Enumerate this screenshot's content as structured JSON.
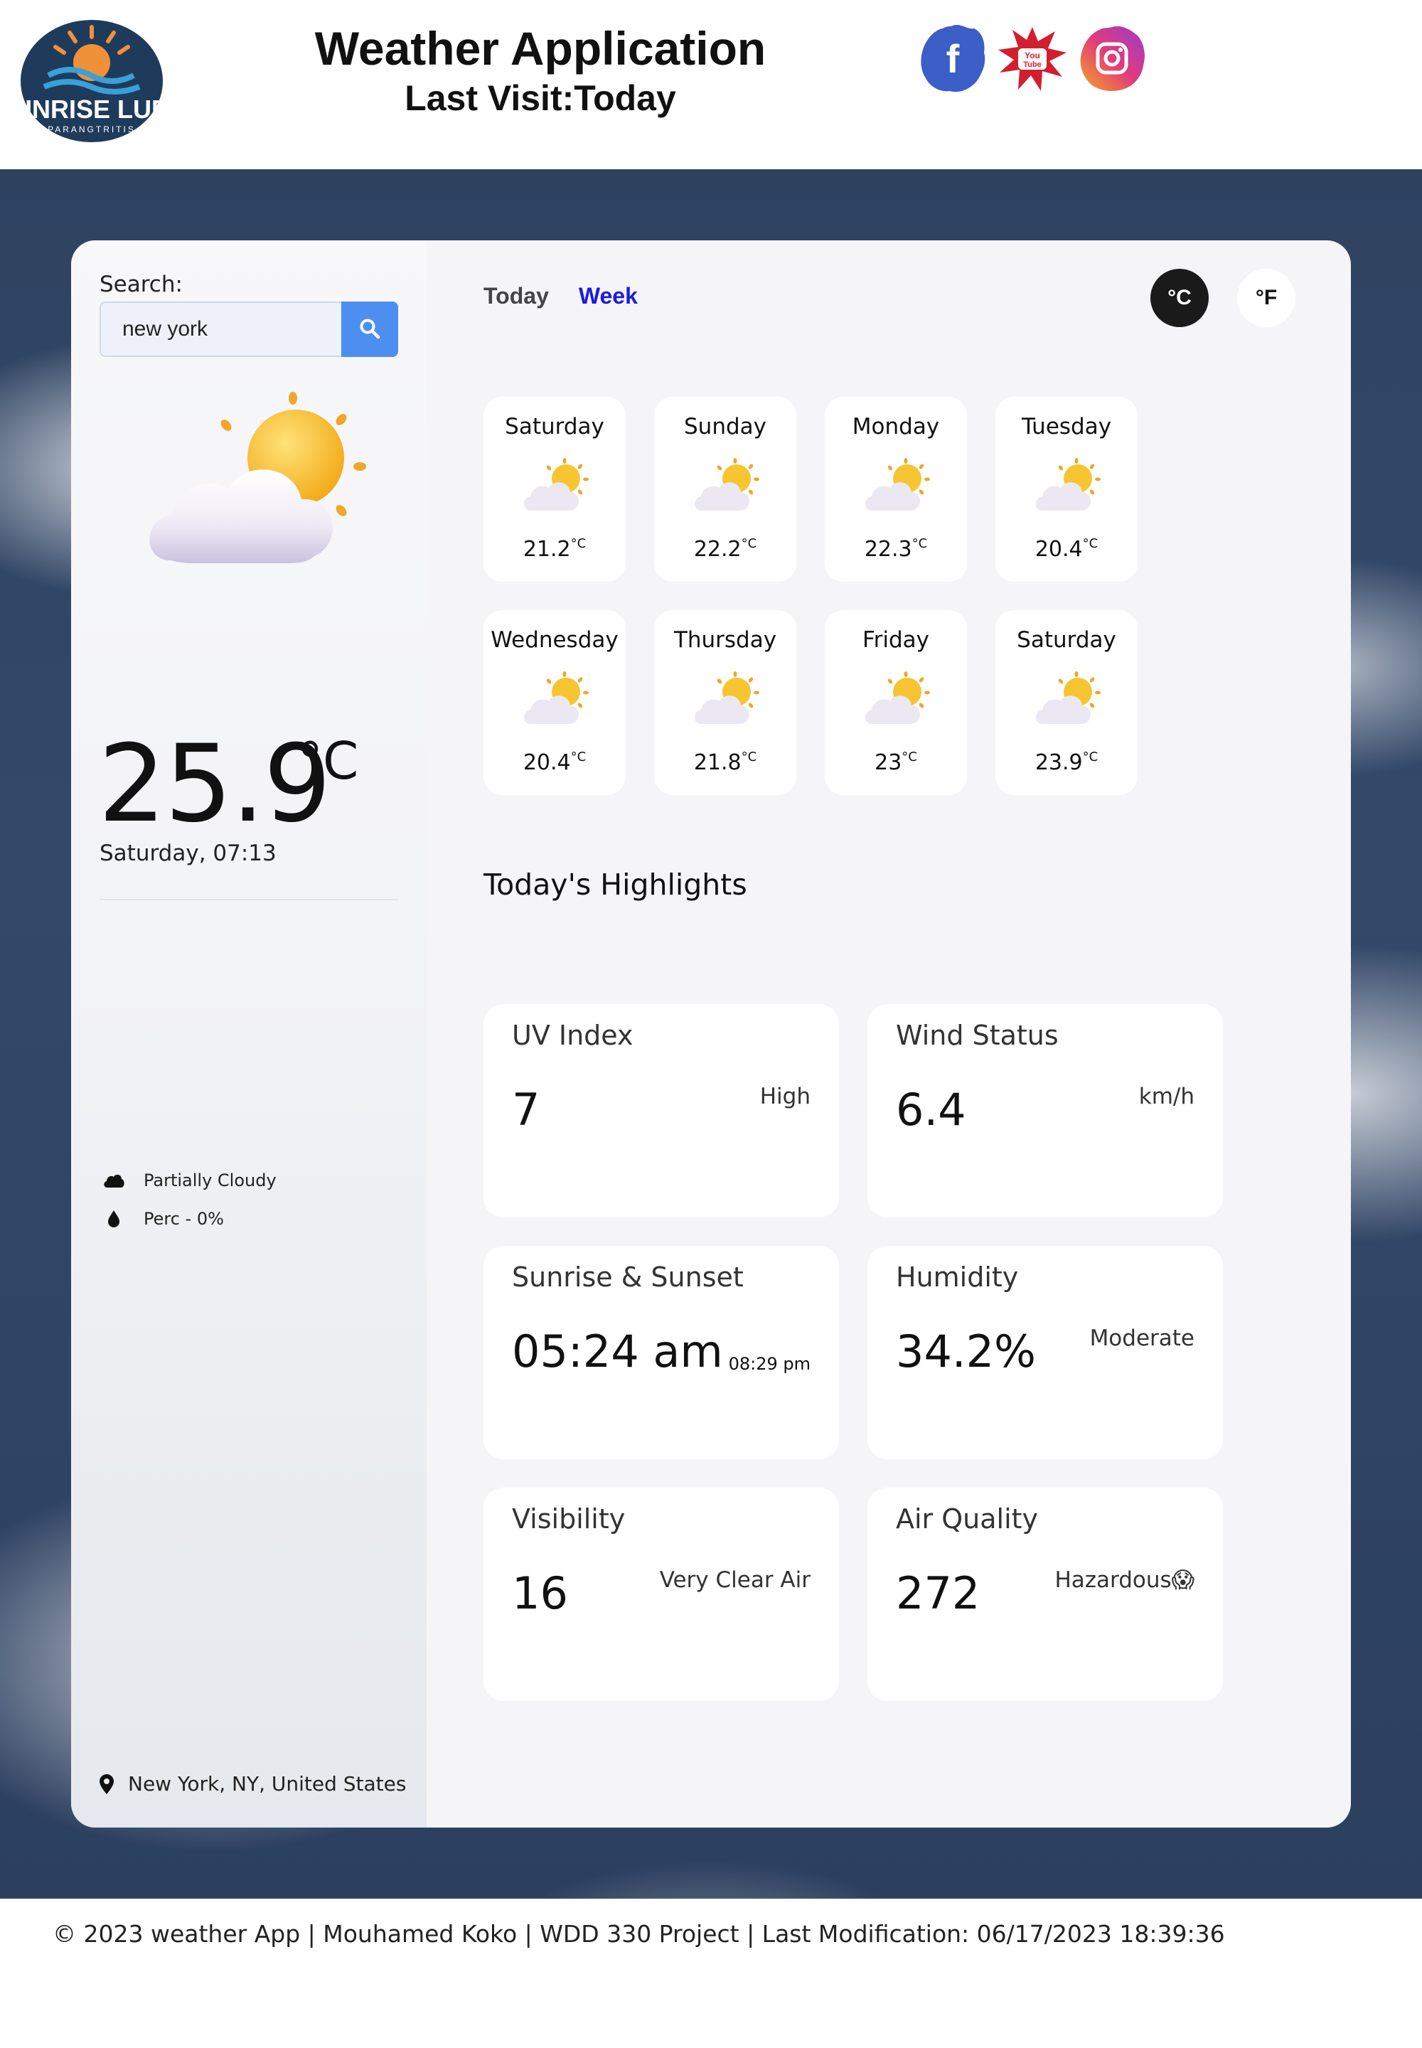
{
  "header": {
    "logo_text": "SUNRISE LURE",
    "logo_subtext": "PARANGTRITIS",
    "title": "Weather Application",
    "last_visit": "Last Visit:Today",
    "social": [
      {
        "name": "facebook",
        "icon": "facebook-icon",
        "color": "#3b5ec7"
      },
      {
        "name": "youtube",
        "icon": "youtube-icon",
        "color": "#d21f2f"
      },
      {
        "name": "instagram",
        "icon": "instagram-icon",
        "color": "#e23b7a"
      }
    ]
  },
  "sidebar": {
    "search_label": "Search:",
    "search_value": "new york",
    "search_icon": "search-icon",
    "current_temp": "25.9",
    "temp_unit": "°C",
    "datetime": "Saturday, 07:13",
    "conditions": [
      {
        "icon": "cloud-icon",
        "text": "Partially Cloudy"
      },
      {
        "icon": "drop-icon",
        "text": "Perc - 0%"
      }
    ],
    "location": "New York, NY, United States"
  },
  "tabs": {
    "today": "Today",
    "week": "Week"
  },
  "units": {
    "celsius": "°C",
    "fahrenheit": "°F"
  },
  "week": [
    {
      "day": "Saturday",
      "temp": "21.2",
      "unit": "°C"
    },
    {
      "day": "Sunday",
      "temp": "22.2",
      "unit": "°C"
    },
    {
      "day": "Monday",
      "temp": "22.3",
      "unit": "°C"
    },
    {
      "day": "Tuesday",
      "temp": "20.4",
      "unit": "°C"
    },
    {
      "day": "Wednesday",
      "temp": "20.4",
      "unit": "°C"
    },
    {
      "day": "Thursday",
      "temp": "21.8",
      "unit": "°C"
    },
    {
      "day": "Friday",
      "temp": "23",
      "unit": "°C"
    },
    {
      "day": "Saturday",
      "temp": "23.9",
      "unit": "°C"
    }
  ],
  "highlights": {
    "title": "Today's Highlights",
    "uv": {
      "title": "UV Index",
      "value": "7",
      "note": "High"
    },
    "wind": {
      "title": "Wind Status",
      "value": "6.4",
      "note": "km/h"
    },
    "sun": {
      "title": "Sunrise & Sunset",
      "value": "05:24 am",
      "note": "08:29 pm"
    },
    "humidity": {
      "title": "Humidity",
      "value": "34.2%",
      "note": "Moderate"
    },
    "visibility": {
      "title": "Visibility",
      "value": "16",
      "note": "Very Clear Air"
    },
    "air": {
      "title": "Air Quality",
      "value": "272",
      "note": "Hazardous😱"
    }
  },
  "footer": {
    "text": "© 2023 weather App | Mouhamed Koko | WDD 330 Project | Last Modification: 06/17/2023 18:39:36"
  },
  "colors": {
    "accent_blue": "#4d8ff1",
    "week_tab": "#1a1ae0",
    "sky": "#2f4361"
  }
}
